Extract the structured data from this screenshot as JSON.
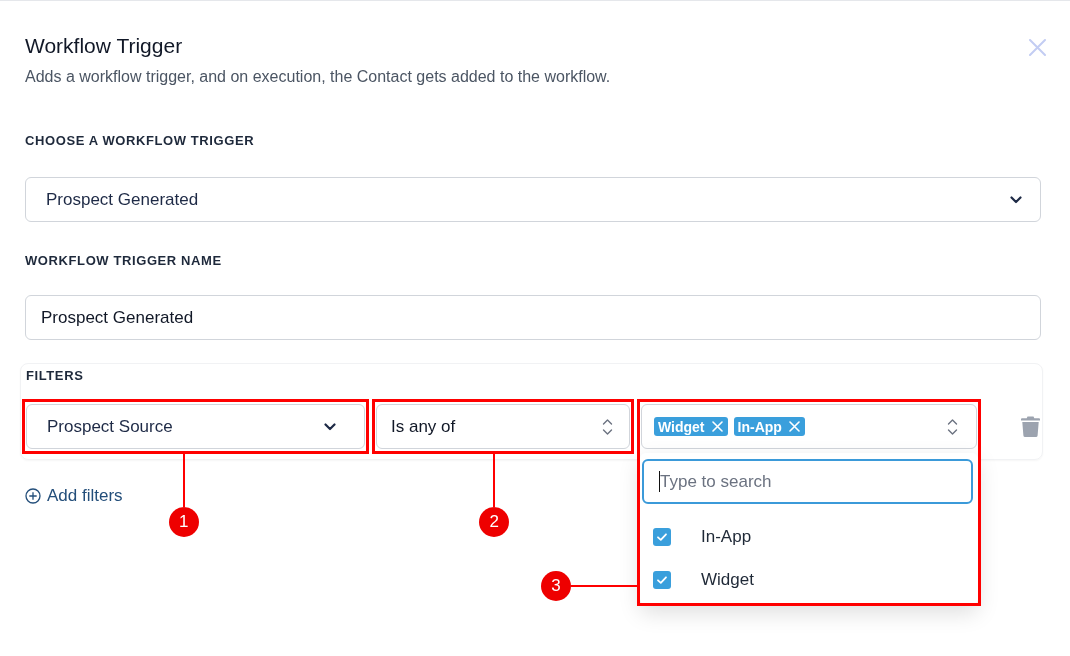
{
  "dialog": {
    "title": "Workflow Trigger",
    "description": "Adds a workflow trigger, and on execution, the Contact gets added to the workflow."
  },
  "trigger": {
    "label": "CHOOSE A WORKFLOW TRIGGER",
    "value": "Prospect Generated"
  },
  "trigger_name": {
    "label": "WORKFLOW TRIGGER NAME",
    "value": "Prospect Generated"
  },
  "filters": {
    "label": "FILTERS",
    "rows": [
      {
        "field": "Prospect Source",
        "operator": "Is any of",
        "tags": [
          "Widget",
          "In-App"
        ],
        "dropdown": {
          "placeholder": "Type to search",
          "options": [
            {
              "label": "In-App",
              "checked": true
            },
            {
              "label": "Widget",
              "checked": true
            }
          ]
        }
      }
    ],
    "add_label": "Add filters"
  },
  "annotations": [
    {
      "label": "1",
      "kind": "below"
    },
    {
      "label": "2",
      "kind": "below"
    },
    {
      "label": "3",
      "kind": "side"
    }
  ]
}
